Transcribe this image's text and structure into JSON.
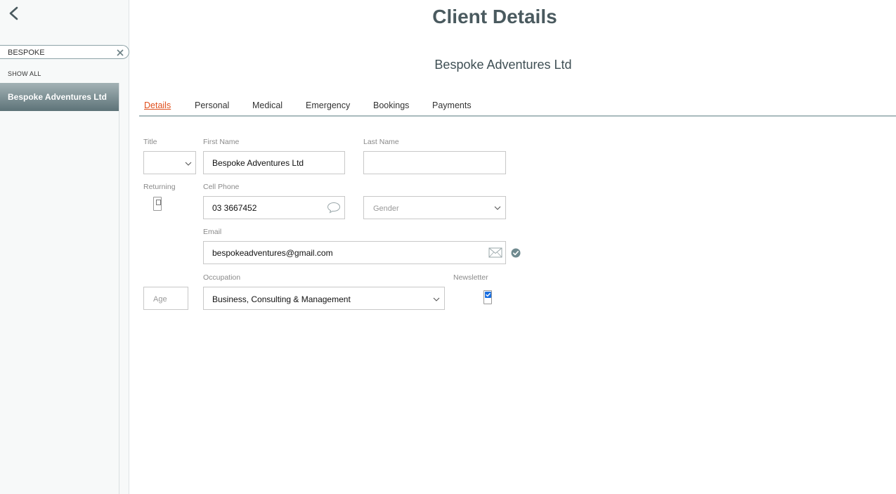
{
  "header": {
    "title": "Client Details",
    "client_name": "Bespoke Adventures Ltd"
  },
  "sidebar": {
    "search": {
      "value": "BESPOKE"
    },
    "show_all_label": "SHOW ALL",
    "results": [
      {
        "label": "Bespoke Adventures Ltd",
        "selected": true
      }
    ]
  },
  "tabs": [
    {
      "label": "Details",
      "active": true
    },
    {
      "label": "Personal",
      "active": false
    },
    {
      "label": "Medical",
      "active": false
    },
    {
      "label": "Emergency",
      "active": false
    },
    {
      "label": "Bookings",
      "active": false
    },
    {
      "label": "Payments",
      "active": false
    }
  ],
  "form": {
    "title": {
      "label": "Title",
      "value": ""
    },
    "first_name": {
      "label": "First Name",
      "value": "Bespoke Adventures Ltd"
    },
    "last_name": {
      "label": "Last Name",
      "value": ""
    },
    "returning": {
      "label": "Returning",
      "checked": false
    },
    "cell_phone": {
      "label": "Cell Phone",
      "value": "03 3667452"
    },
    "gender": {
      "placeholder": "Gender"
    },
    "email": {
      "label": "Email",
      "value": "bespokeadventures@gmail.com"
    },
    "age": {
      "placeholder": "Age"
    },
    "occupation": {
      "label": "Occupation",
      "value": "Business, Consulting & Management"
    },
    "newsletter": {
      "label": "Newsletter",
      "checked": true
    }
  },
  "icons": {
    "back": "chevron-left-icon",
    "clear": "close-icon",
    "sms": "speech-bubble-icon",
    "mail": "envelope-icon",
    "verified": "check-circle-icon"
  },
  "colors": {
    "accent": "#e0501e",
    "sidebar_selected": "#6f8387",
    "title_text": "#4a5a5f",
    "verified_icon": "#6f8a8f"
  }
}
